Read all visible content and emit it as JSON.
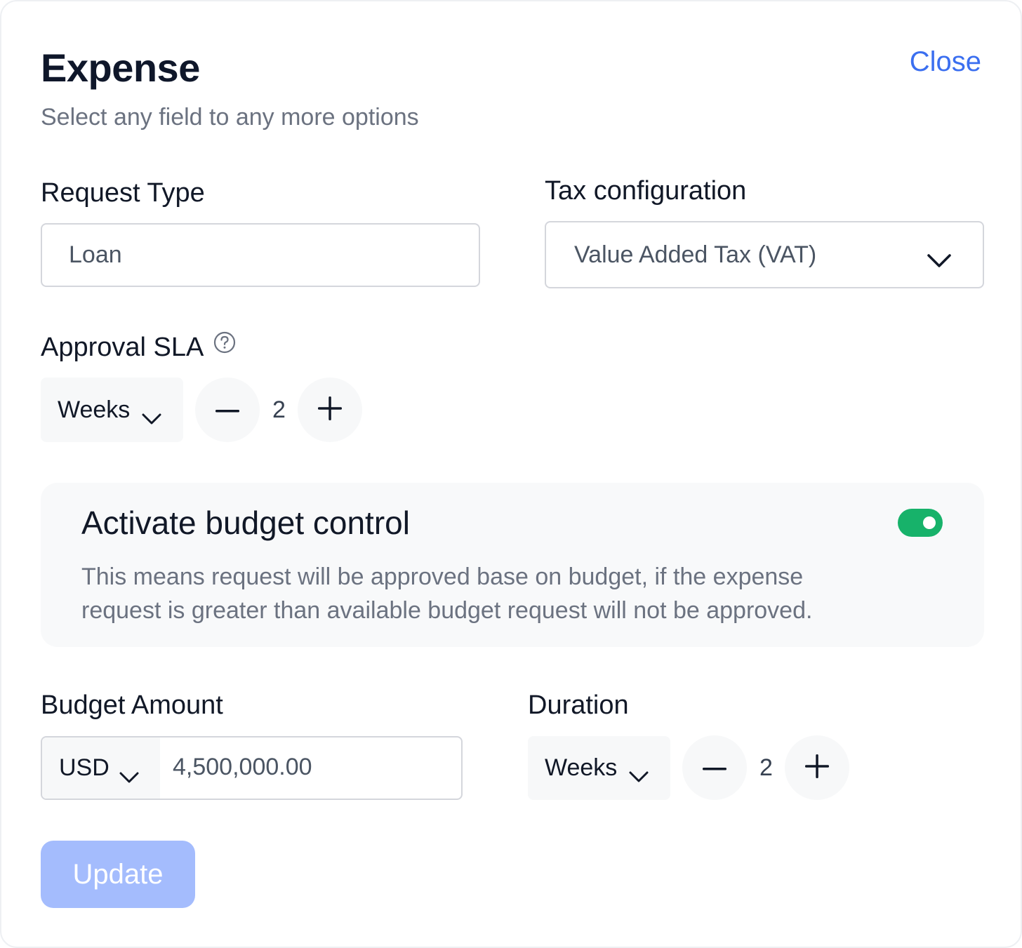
{
  "header": {
    "title": "Expense",
    "close_label": "Close",
    "subtitle": "Select any field to any more options"
  },
  "request_type": {
    "label": "Request Type",
    "value": "Loan"
  },
  "tax": {
    "label": "Tax configuration",
    "value": "Value Added Tax (VAT)",
    "icon": "chevron-down-icon"
  },
  "approval_sla": {
    "label": "Approval SLA",
    "help_icon": "question-circle-icon",
    "unit": "Weeks",
    "value": "2"
  },
  "budget_control": {
    "title": "Activate budget control",
    "description": "This means request will be approved base on budget, if the expense request is greater than available budget request will not be approved.",
    "enabled": true,
    "toggle_color": "#17b26a"
  },
  "budget_amount": {
    "label": "Budget Amount",
    "currency": "USD",
    "value": "4,500,000.00"
  },
  "duration": {
    "label": "Duration",
    "unit": "Weeks",
    "value": "2"
  },
  "actions": {
    "update_label": "Update",
    "update_color": "#a4bcfd"
  },
  "colors": {
    "accent": "#3b6ff0"
  }
}
